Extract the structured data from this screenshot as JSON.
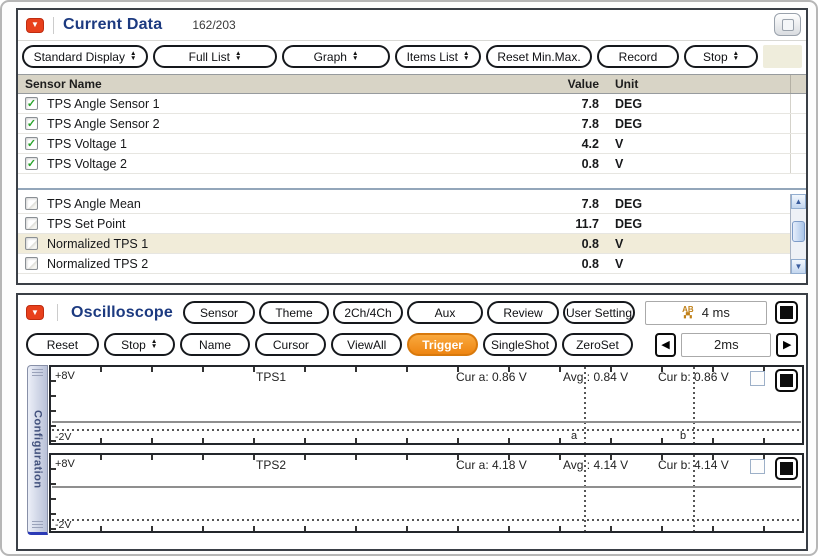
{
  "colors": {
    "accent_red": "#e8401c",
    "title_blue": "#1c3a80",
    "trigger_orange": "#f7941d",
    "row_highlight": "#f1ecd9",
    "table_header_bg": "#d8d4c6"
  },
  "icons": {
    "panel_arrow": "▼",
    "check": "✓",
    "scroll_up": "▲",
    "scroll_down": "▼",
    "arrow_left": "◀",
    "arrow_right": "▶",
    "ab_cursor": "AB"
  },
  "current_data": {
    "title": "Current Data",
    "counter": "162/203",
    "buttons": {
      "display_mode": "Standard Display",
      "list_mode": "Full List",
      "view_mode": "Graph",
      "items_list": "Items List",
      "reset_minmax": "Reset Min.Max.",
      "record": "Record",
      "stop": "Stop"
    },
    "headers": {
      "sensor": "Sensor Name",
      "value": "Value",
      "unit": "Unit"
    },
    "rows_checked": [
      {
        "name": "TPS Angle Sensor 1",
        "value": "7.8",
        "unit": "DEG"
      },
      {
        "name": "TPS Angle Sensor 2",
        "value": "7.8",
        "unit": "DEG"
      },
      {
        "name": "TPS Voltage 1",
        "value": "4.2",
        "unit": "V"
      },
      {
        "name": "TPS Voltage 2",
        "value": "0.8",
        "unit": "V"
      }
    ],
    "rows_unchecked": [
      {
        "name": "TPS Angle Mean",
        "value": "7.8",
        "unit": "DEG"
      },
      {
        "name": "TPS Set Point",
        "value": "11.7",
        "unit": "DEG"
      },
      {
        "name": "Normalized TPS 1",
        "value": "0.8",
        "unit": "V"
      },
      {
        "name": "Normalized TPS 2",
        "value": "0.8",
        "unit": "V"
      }
    ]
  },
  "oscilloscope": {
    "title": "Oscilloscope",
    "buttons_row1": {
      "sensor": "Sensor",
      "theme": "Theme",
      "ch_mode": "2Ch/4Ch",
      "aux": "Aux",
      "review": "Review",
      "user_setting": "User Setting"
    },
    "ab_time": "4 ms",
    "buttons_row2": {
      "reset": "Reset",
      "stop": "Stop",
      "name": "Name",
      "cursor": "Cursor",
      "view_all": "ViewAll",
      "trigger": "Trigger",
      "single_shot": "SingleShot",
      "zero_set": "ZeroSet"
    },
    "timebase": "2ms",
    "side_tab": "Configuration",
    "channels": [
      {
        "name": "TPS1",
        "v_top": "+8V",
        "v_bottom": "-2V",
        "cur_a": "Cur a: 0.86 V",
        "avg": "Avg : 0.84 V",
        "cur_b": "Cur b: 0.86 V",
        "marker_a": "a",
        "marker_b": "b"
      },
      {
        "name": "TPS2",
        "v_top": "+8V",
        "v_bottom": "-2V",
        "cur_a": "Cur a: 4.18 V",
        "avg": "Avg : 4.14 V",
        "cur_b": "Cur b: 4.14 V"
      }
    ]
  }
}
